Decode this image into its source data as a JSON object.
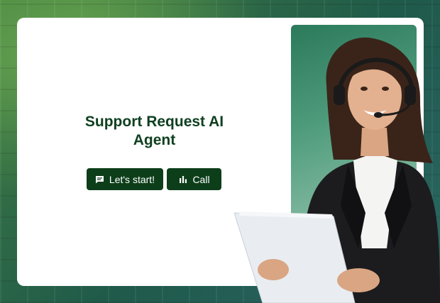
{
  "main": {
    "title": "Support Request AI Agent",
    "start_label": "Let's start!",
    "call_label": "Call"
  },
  "icons": {
    "start": "chat-bubble-icon",
    "call": "audio-bars-icon"
  },
  "colors": {
    "accent": "#0d3e1a",
    "title": "#0f4020",
    "card": "#ffffff"
  }
}
